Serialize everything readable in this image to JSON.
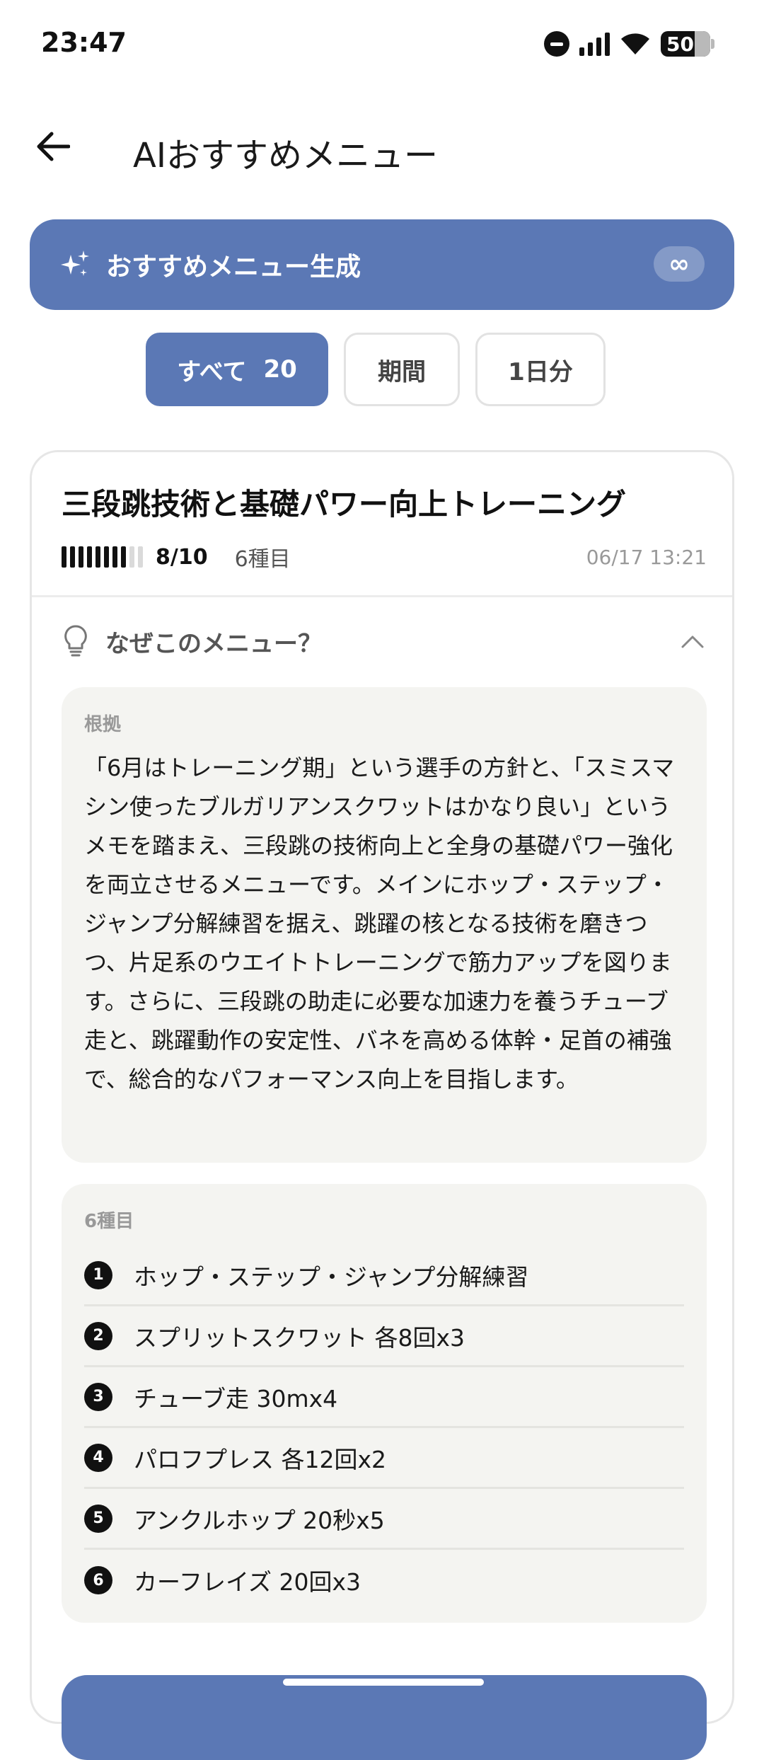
{
  "status_bar": {
    "time": "23:47",
    "battery": "50"
  },
  "app_bar": {
    "back_icon": "arrow-left-icon",
    "title": "AIおすすめメニュー"
  },
  "generate": {
    "icon": "sparkle-icon",
    "label": "おすすめメニュー生成",
    "badge": "∞"
  },
  "filters": [
    {
      "label": "すべて",
      "count": "20",
      "active": true
    },
    {
      "label": "期間",
      "active": false
    },
    {
      "label": "1日分",
      "active": false
    }
  ],
  "card": {
    "title": "三段跳技術と基礎パワー向上トレーニング",
    "level": 8,
    "level_max": 10,
    "level_text": "8/10",
    "item_count": "6種目",
    "date": "06/17 13:21",
    "why_label": "なぜこのメニュー？",
    "reason_label": "根拠",
    "reason_text": "「6月はトレーニング期」という選手の方針と、「スミスマシン使ったブルガリアンスクワットはかなり良い」というメモを踏まえ、三段跳の技術向上と全身の基礎パワー強化を両立させるメニューです。メインにホップ・ステップ・ジャンプ分解練習を据え、跳躍の核となる技術を磨きつつ、片足系のウエイトトレーニングで筋力アップを図ります。さらに、三段跳の助走に必要な加速力を養うチューブ走と、跳躍動作の安定性、バネを高める体幹・足首の補強で、総合的なパフォーマンス向上を目指します。",
    "exercise_label": "6種目",
    "exercises": [
      {
        "num": "1",
        "name": "ホップ・ステップ・ジャンプ分解練習"
      },
      {
        "num": "2",
        "name": "スプリットスクワット 各8回x3"
      },
      {
        "num": "3",
        "name": "チューブ走 30mx4"
      },
      {
        "num": "4",
        "name": "パロフプレス 各12回x2"
      },
      {
        "num": "5",
        "name": "アンクルホップ 20秒x5"
      },
      {
        "num": "6",
        "name": "カーフレイズ 20回x3"
      }
    ]
  },
  "colors": {
    "accent": "#5b78b5",
    "panel": "#f4f4f1"
  }
}
